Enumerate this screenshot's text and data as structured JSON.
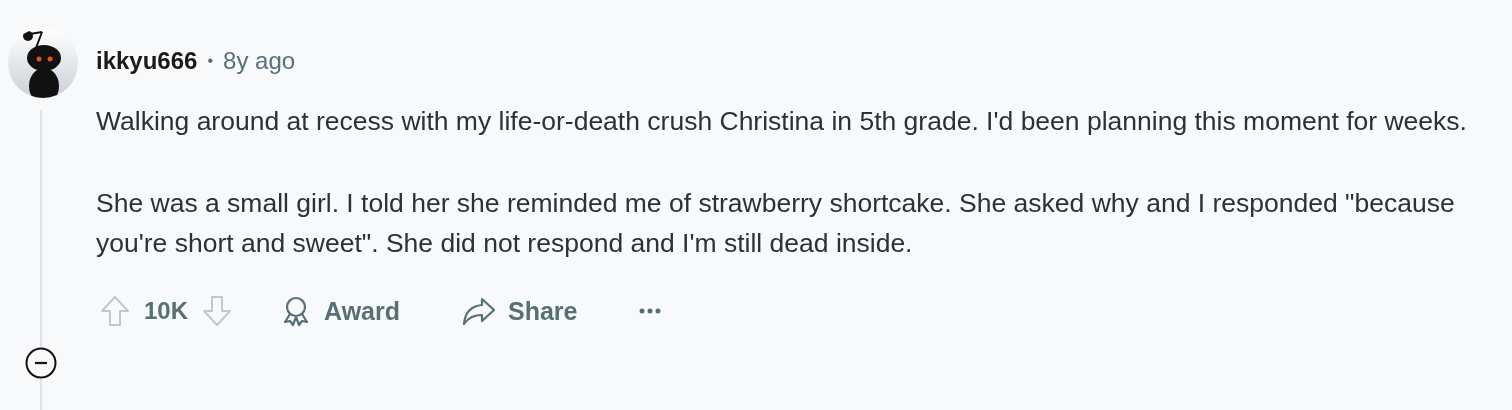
{
  "comment": {
    "author": "ikkyu666",
    "separator": "•",
    "age": "8y ago",
    "paragraphs": [
      "Walking around at recess with my life-or-death crush Christina in 5th grade. I'd been planning this moment for weeks.",
      "She was a small girl. I told her she reminded me of strawberry shortcake. She asked why and I responded \"because you're short and sweet\". She did not respond and I'm still dead inside."
    ],
    "score": "10K",
    "award_label": "Award",
    "share_label": "Share"
  }
}
